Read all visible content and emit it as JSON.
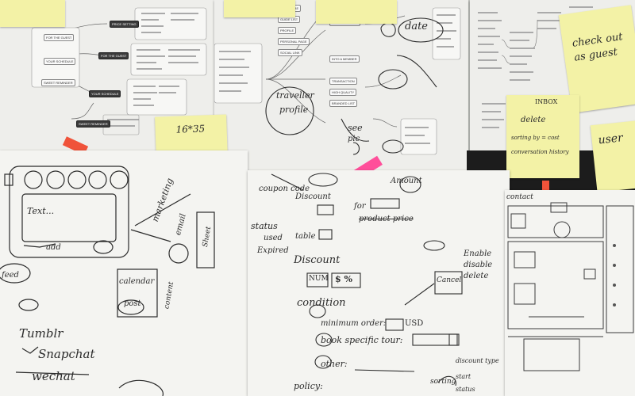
{
  "colors": {
    "wall": "#cfd1cc",
    "paper": "#f4f4f1",
    "sticky_yellow": "#f3f2a6",
    "tape_pink": "#ff4f9a",
    "tape_red": "#f0533a",
    "dark_strip": "#1c1c1c"
  },
  "mindmap_top_left": {
    "nodes": [
      "PRICE SETTING",
      "FOR THE GUEST",
      "YOUR SCHEDULE",
      "SWEET REMINDER",
      "FOR THE GUEST",
      "YOUR SCHEDULE",
      "SWEET REMINDER"
    ]
  },
  "mindmap_top_center": {
    "nodes": [
      "SUBSCRIBE",
      "GUIDE LIST",
      "PROFILE",
      "PERSONAL PAGE",
      "SOCIAL LINK",
      "YOUR SHOP",
      "YOUR LOCATION",
      "INTO A MEMBER",
      "TRANSACTION",
      "HIGH QUALITY",
      "BRANDED LIST"
    ],
    "hand_traveller": "traveller",
    "hand_profile": "profile",
    "hand_pic": "pic",
    "hand_date": "date",
    "hand_see": "see"
  },
  "sticky_notes": {
    "small_center": "16*35",
    "top_right": "check out as guest",
    "inbox_title": "INBOX",
    "inbox_delete": "delete",
    "inbox_sort": "sorting by = cost",
    "inbox_history": "conversation history",
    "right_edge": "user"
  },
  "sheet_left": {
    "text_box": "Text...",
    "label_marketing": "marketing",
    "label_email": "email",
    "label_calendar": "calendar",
    "label_post": "post",
    "label_tumblr": "Tumblr",
    "label_snapchat": "Snapchat",
    "label_wechat": "wechat",
    "label_sheet": "Sheet",
    "label_content": "content",
    "label_feed": "feed",
    "label_add": "add"
  },
  "sheet_middle": {
    "coupon_code": "coupon code",
    "discount_top": "Discount",
    "amount": "Amount",
    "for": "for",
    "product_price": "product price",
    "status": "status",
    "used": "used",
    "expired": "Expired",
    "table": "table",
    "discount": "Discount",
    "num": "NUM",
    "money": "$ %",
    "enable": "Enable",
    "disable": "disable",
    "delete": "delete",
    "cancel": "Cancel",
    "condition": "condition",
    "minimum_order": "minimum order:",
    "usd": "USD",
    "book_specific": "book specific tour:",
    "other": "other:",
    "policy": "policy:",
    "sorting": "sorting",
    "discount_type": "discount type",
    "start": "start",
    "status_bottom": "status"
  },
  "sheet_right": {
    "contact": "contact"
  }
}
